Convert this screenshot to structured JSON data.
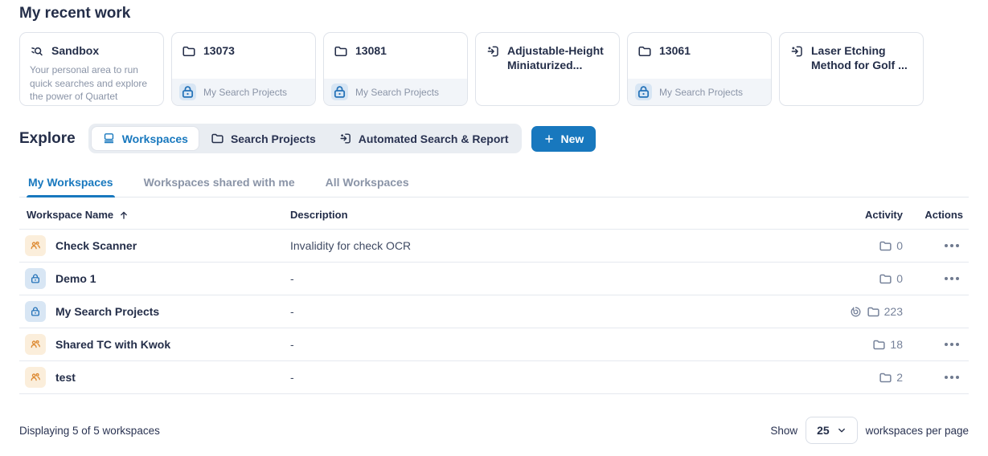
{
  "colors": {
    "accent": "#1878BE",
    "navy": "#242E49",
    "muted_gray": "#8A94A7",
    "orange_icon": "#DD8A33",
    "lock_blue": "#2472B8",
    "chip_blue_bg": "#D8E6F4",
    "chip_orange_bg": "#FBEEDB"
  },
  "recent": {
    "title": "My recent work",
    "cards": [
      {
        "icon": "sandbox-search-icon",
        "title": "Sandbox",
        "description": "Your personal area to run quick searches and explore the power of Quartet",
        "footer": null
      },
      {
        "icon": "folder-icon",
        "title": "13073",
        "description": null,
        "footer": "My Search Projects"
      },
      {
        "icon": "folder-icon",
        "title": "13081",
        "description": null,
        "footer": "My Search Projects"
      },
      {
        "icon": "automated-report-icon",
        "title": "Adjustable-Height Miniaturized...",
        "description": null,
        "footer": null
      },
      {
        "icon": "folder-icon",
        "title": "13061",
        "description": null,
        "footer": "My Search Projects"
      },
      {
        "icon": "automated-report-icon",
        "title": "Laser Etching Method for Golf ...",
        "description": null,
        "footer": null
      }
    ]
  },
  "explore": {
    "title": "Explore",
    "segments": [
      {
        "label": "Workspaces",
        "icon": "workspaces-icon",
        "active": true
      },
      {
        "label": "Search Projects",
        "icon": "folder-icon",
        "active": false
      },
      {
        "label": "Automated Search & Report",
        "icon": "automated-report-icon",
        "active": false
      }
    ],
    "new_button_label": "New"
  },
  "tabs": [
    {
      "label": "My Workspaces",
      "active": true
    },
    {
      "label": "Workspaces shared with me",
      "active": false
    },
    {
      "label": "All Workspaces",
      "active": false
    }
  ],
  "table": {
    "columns": {
      "name": "Workspace Name",
      "description": "Description",
      "activity": "Activity",
      "actions": "Actions"
    },
    "sort": {
      "column": "Workspace Name",
      "direction": "ascending"
    },
    "rows": [
      {
        "icon": "people-icon",
        "name": "Check Scanner",
        "description": "Invalidity for check OCR",
        "activity_count": "0",
        "has_target": false,
        "has_actions": true
      },
      {
        "icon": "lock-icon",
        "name": "Demo 1",
        "description": "-",
        "activity_count": "0",
        "has_target": false,
        "has_actions": true
      },
      {
        "icon": "lock-icon",
        "name": "My Search Projects",
        "description": "-",
        "activity_count": "223",
        "has_target": true,
        "has_actions": false
      },
      {
        "icon": "people-icon",
        "name": "Shared TC with Kwok",
        "description": "-",
        "activity_count": "18",
        "has_target": false,
        "has_actions": true
      },
      {
        "icon": "people-icon",
        "name": "test",
        "description": "-",
        "activity_count": "2",
        "has_target": false,
        "has_actions": true
      }
    ]
  },
  "footer": {
    "summary": "Displaying 5 of 5 workspaces",
    "show_label": "Show",
    "page_size_value": "25",
    "per_page_label": "workspaces per page"
  }
}
